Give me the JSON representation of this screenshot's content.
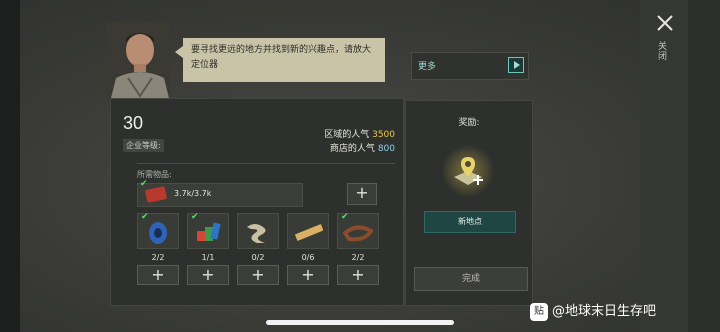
{
  "speech": {
    "text": "要寻找更远的地方并找到新的兴趣点，请放大定位器"
  },
  "more": {
    "label": "更多"
  },
  "company": {
    "level": "30",
    "level_label": "企业等级:"
  },
  "popularity": {
    "region_label": "区域的人气",
    "region_value": "3500",
    "shop_label": "商店的人气",
    "shop_value": "800"
  },
  "required": {
    "label": "所需物品:",
    "resource": {
      "amount": "3.7k/3.7k",
      "icon": "card-icon"
    },
    "items": [
      {
        "icon": "wire-spool-icon",
        "count": "2/2",
        "checked": true
      },
      {
        "icon": "books-icon",
        "count": "1/1",
        "checked": true
      },
      {
        "icon": "fabric-icon",
        "count": "0/2",
        "checked": false
      },
      {
        "icon": "wood-plank-icon",
        "count": "0/6",
        "checked": false
      },
      {
        "icon": "belt-icon",
        "count": "2/2",
        "checked": true
      }
    ]
  },
  "reward": {
    "label": "奖励:",
    "icon": "map-pin-plus-icon",
    "new_point": "新地点"
  },
  "done": {
    "label": "完成"
  },
  "side_text": "关闭",
  "watermark": {
    "text": "@地球末日生存吧",
    "logo": "贴"
  },
  "colors": {
    "accent_teal": "#1f4643",
    "popularity_gold": "#e7c84e",
    "popularity_blue": "#8ecfe6",
    "check_green": "#5fdc6f"
  }
}
